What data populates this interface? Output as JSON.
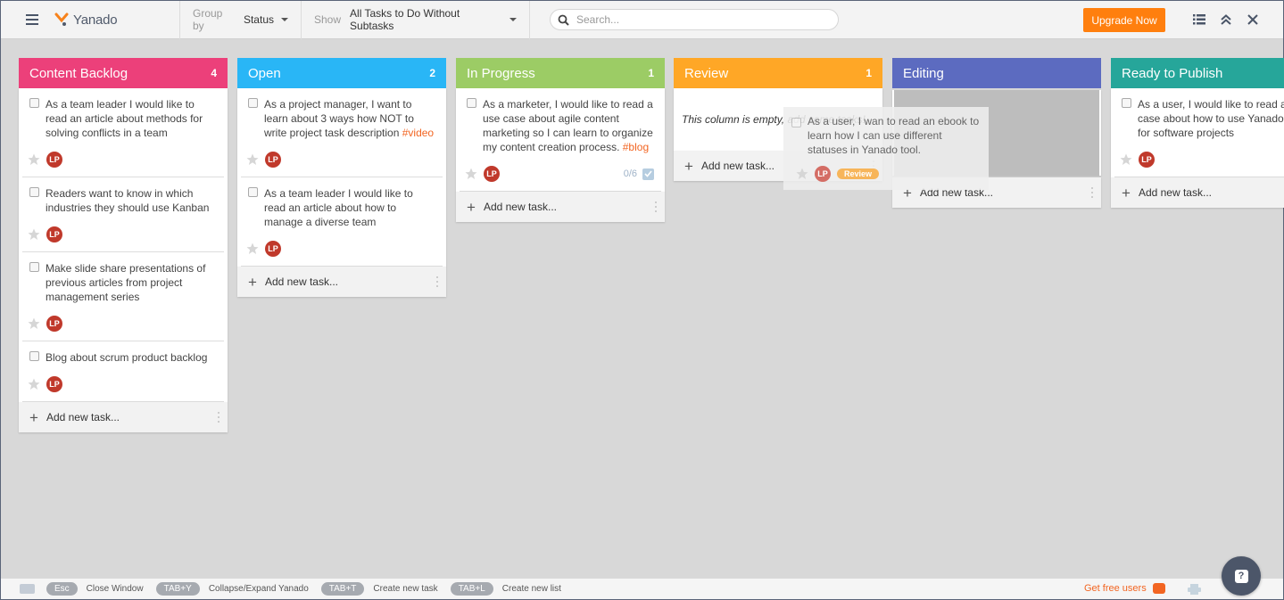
{
  "app": {
    "name": "Yanado"
  },
  "toolbar": {
    "group_by_label": "Group by",
    "group_by_value": "Status",
    "show_label": "Show",
    "show_value": "All Tasks to Do Without Subtasks",
    "search_placeholder": "Search...",
    "search_value": "",
    "upgrade_label": "Upgrade Now",
    "accent_color": "#ff7f0e"
  },
  "columns": [
    {
      "title": "Content Backlog",
      "count": "4",
      "color": "#ec407a",
      "cards": [
        {
          "text": "As a team leader I would like to read an article about methods for solving conflicts in a team",
          "tag": "",
          "assignee": "LP"
        },
        {
          "text": "Readers want to know in which industries they should use Kanban",
          "tag": "",
          "assignee": "LP"
        },
        {
          "text": "Make slide share presentations of previous articles from project management series",
          "tag": "",
          "assignee": "LP"
        },
        {
          "text": "Blog about scrum product backlog",
          "tag": "",
          "assignee": "LP"
        }
      ]
    },
    {
      "title": "Open",
      "count": "2",
      "color": "#29b6f6",
      "cards": [
        {
          "text": "As a project manager, I want to learn about 3 ways how NOT to write project task description ",
          "tag": "#video",
          "assignee": "LP"
        },
        {
          "text": "As a team leader I would like to read an article about how to manage a diverse team",
          "tag": "",
          "assignee": "LP"
        }
      ]
    },
    {
      "title": "In Progress",
      "count": "1",
      "color": "#9ccc65",
      "cards": [
        {
          "text": "As a marketer, I would like to read a use case about agile content marketing so I can learn to organize my content creation process. ",
          "tag": "#blog",
          "assignee": "LP",
          "subtasks": "0/6"
        }
      ]
    },
    {
      "title": "Review",
      "count": "1",
      "color": "#ffa726",
      "empty_message": "This column is empty, add some tasks!",
      "cards": []
    },
    {
      "title": "Editing",
      "count": "",
      "color": "#5c6bc0",
      "cards": []
    },
    {
      "title": "Ready to Publish",
      "count": "",
      "color": "#26a69a",
      "cards": [
        {
          "text": "As a user, I would like to read a use case about how to use Yanado tool for software projects",
          "tag": "",
          "assignee": "LP"
        }
      ]
    }
  ],
  "add_task_label": "Add new task...",
  "dragging_card": {
    "text": "As a user, I wan to read an ebook to learn how I can use different statuses in Yanado tool.",
    "assignee": "LP",
    "status_badge": "Review"
  },
  "footer": {
    "shortcuts": [
      {
        "key": "Esc",
        "desc": "Close Window"
      },
      {
        "key": "TAB+Y",
        "desc": "Collapse/Expand Yanado"
      },
      {
        "key": "TAB+T",
        "desc": "Create new task"
      },
      {
        "key": "TAB+L",
        "desc": "Create new list"
      }
    ],
    "free_users_label": "Get free users"
  },
  "help": {
    "glyph": "?"
  }
}
